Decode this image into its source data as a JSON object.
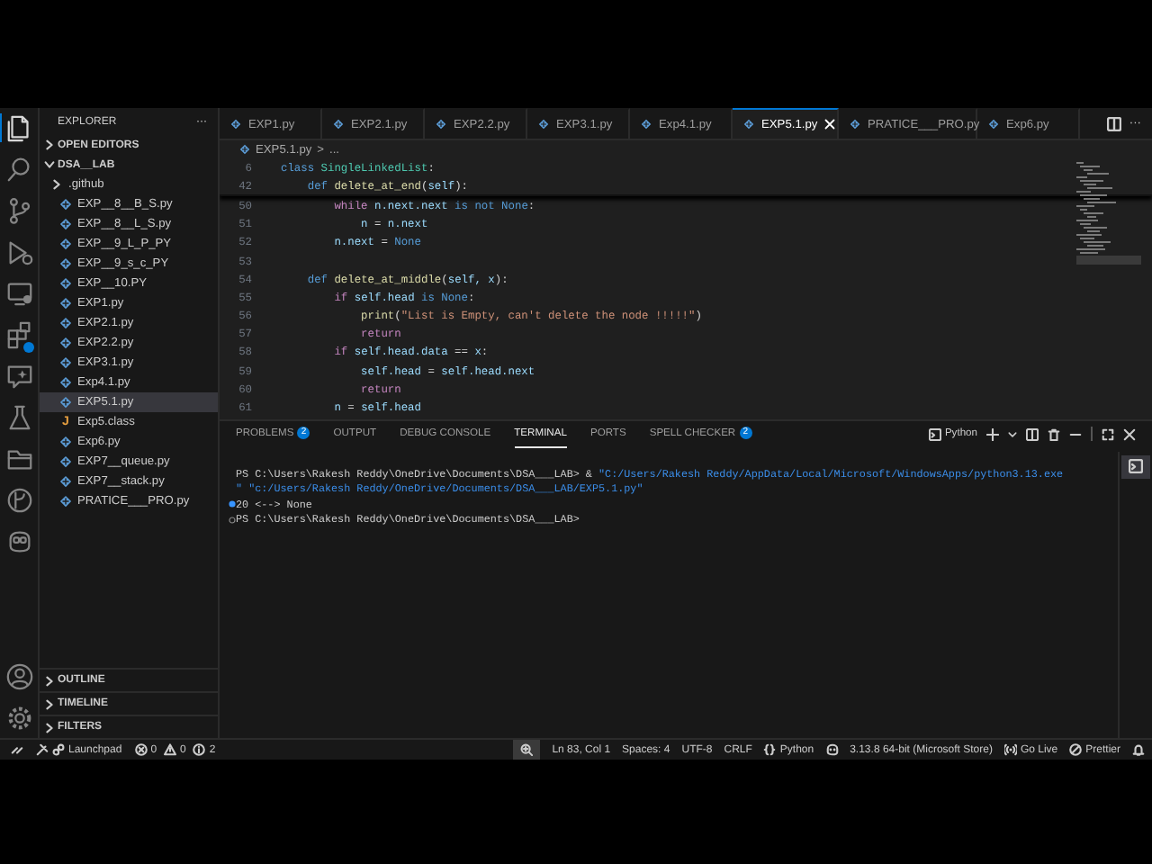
{
  "activity_bar": {
    "items": [
      {
        "kind": "explorer",
        "selected": true,
        "badge": false
      },
      {
        "kind": "search",
        "selected": false,
        "badge": false
      },
      {
        "kind": "source-control",
        "selected": false,
        "badge": false
      },
      {
        "kind": "run-debug",
        "selected": false,
        "badge": false
      },
      {
        "kind": "remote",
        "selected": false,
        "badge": false
      },
      {
        "kind": "extensions",
        "selected": false,
        "badge": true
      },
      {
        "kind": "chat",
        "selected": false,
        "badge": false
      },
      {
        "kind": "testing",
        "selected": false,
        "badge": false
      },
      {
        "kind": "folder",
        "selected": false,
        "badge": false
      },
      {
        "kind": "git-graph",
        "selected": false,
        "badge": false
      },
      {
        "kind": "robot",
        "selected": false,
        "badge": false
      }
    ],
    "bottom": [
      {
        "kind": "account",
        "selected": false
      },
      {
        "kind": "settings",
        "selected": false
      }
    ]
  },
  "sidebar": {
    "title": "EXPLORER",
    "more": "···",
    "sections": [
      {
        "label": "OPEN EDITORS",
        "expanded": false
      },
      {
        "label": "DSA__LAB",
        "expanded": true
      }
    ],
    "items": [
      {
        "kind": "folder",
        "label": ".github",
        "expanded": false,
        "selected": false
      },
      {
        "kind": "python",
        "label": "EXP__8__B_S.py",
        "selected": false
      },
      {
        "kind": "python",
        "label": "EXP__8__L_S.py",
        "selected": false
      },
      {
        "kind": "python",
        "label": "EXP__9_L_P_PY",
        "selected": false
      },
      {
        "kind": "python",
        "label": "EXP__9_s_c_PY",
        "selected": false
      },
      {
        "kind": "python",
        "label": "EXP__10.PY",
        "selected": false
      },
      {
        "kind": "python",
        "label": "EXP1.py",
        "selected": false
      },
      {
        "kind": "python",
        "label": "EXP2.1.py",
        "selected": false
      },
      {
        "kind": "python",
        "label": "EXP2.2.py",
        "selected": false
      },
      {
        "kind": "python",
        "label": "EXP3.1.py",
        "selected": false
      },
      {
        "kind": "python",
        "label": "Exp4.1.py",
        "selected": false
      },
      {
        "kind": "python",
        "label": "EXP5.1.py",
        "selected": true
      },
      {
        "kind": "java",
        "glyph": "J",
        "label": "Exp5.class",
        "selected": false
      },
      {
        "kind": "python",
        "label": "Exp6.py",
        "selected": false
      },
      {
        "kind": "python",
        "label": "EXP7__queue.py",
        "selected": false
      },
      {
        "kind": "python",
        "label": "EXP7__stack.py",
        "selected": false
      },
      {
        "kind": "python",
        "label": "PRATICE___PRO.py",
        "selected": false
      }
    ],
    "bottom_sections": [
      {
        "label": "OUTLINE",
        "expanded": false
      },
      {
        "label": "TIMELINE",
        "expanded": false
      },
      {
        "label": "FILTERS",
        "expanded": false
      }
    ]
  },
  "editor": {
    "tabs": [
      {
        "label": "EXP1.py",
        "selected": false
      },
      {
        "label": "EXP2.1.py",
        "selected": false
      },
      {
        "label": "EXP2.2.py",
        "selected": false
      },
      {
        "label": "EXP3.1.py",
        "selected": false
      },
      {
        "label": "Exp4.1.py",
        "selected": false
      },
      {
        "label": "EXP5.1.py",
        "selected": true
      },
      {
        "label": "PRATICE___PRO.py",
        "selected": false
      },
      {
        "label": "Exp6.py",
        "selected": false
      }
    ],
    "tab_more": "···",
    "breadcrumb": {
      "file": "EXP5.1.py",
      "separator": ">",
      "rest": "..."
    },
    "sticky_lines": [
      {
        "number": "6",
        "tokens": [
          {
            "kind": "kw",
            "text": "class "
          },
          {
            "kind": "cls",
            "text": "SingleLinkedList"
          },
          {
            "kind": "op",
            "text": ":"
          }
        ]
      },
      {
        "number": "42",
        "tokens": [
          {
            "kind": "kw",
            "text": "    def "
          },
          {
            "kind": "fn",
            "text": "delete_at_end"
          },
          {
            "kind": "op",
            "text": "("
          },
          {
            "kind": "var",
            "text": "self"
          },
          {
            "kind": "op",
            "text": "):"
          }
        ]
      }
    ],
    "lines": [
      {
        "number": "50",
        "tokens": [
          {
            "kind": "ctl",
            "text": "        while "
          },
          {
            "kind": "var",
            "text": "n.next.next"
          },
          {
            "kind": "kw",
            "text": " is not None"
          },
          {
            "kind": "op",
            "text": ":"
          }
        ]
      },
      {
        "number": "51",
        "tokens": [
          {
            "kind": "var",
            "text": "            n"
          },
          {
            "kind": "op",
            "text": " = "
          },
          {
            "kind": "var",
            "text": "n.next"
          }
        ]
      },
      {
        "number": "52",
        "tokens": [
          {
            "kind": "var",
            "text": "        n.next"
          },
          {
            "kind": "op",
            "text": " = "
          },
          {
            "kind": "kw",
            "text": "None"
          }
        ]
      },
      {
        "number": "53"
      },
      {
        "number": "54",
        "tokens": [
          {
            "kind": "kw",
            "text": "    def "
          },
          {
            "kind": "fn",
            "text": "delete_at_middle"
          },
          {
            "kind": "op",
            "text": "("
          },
          {
            "kind": "var",
            "text": "self, x"
          },
          {
            "kind": "op",
            "text": "):"
          }
        ]
      },
      {
        "number": "55",
        "tokens": [
          {
            "kind": "ctl",
            "text": "        if "
          },
          {
            "kind": "var",
            "text": "self.head"
          },
          {
            "kind": "kw",
            "text": " is None"
          },
          {
            "kind": "op",
            "text": ":"
          }
        ]
      },
      {
        "number": "56",
        "tokens": [
          {
            "kind": "fn",
            "text": "            print"
          },
          {
            "kind": "op",
            "text": "("
          },
          {
            "kind": "str",
            "text": "\"List is Empty, can't delete the node !!!!!\""
          },
          {
            "kind": "op",
            "text": ")"
          }
        ]
      },
      {
        "number": "57",
        "tokens": [
          {
            "kind": "ctl",
            "text": "            return"
          }
        ]
      },
      {
        "number": "58",
        "tokens": [
          {
            "kind": "ctl",
            "text": "        if "
          },
          {
            "kind": "var",
            "text": "self.head.data"
          },
          {
            "kind": "op",
            "text": " == "
          },
          {
            "kind": "var",
            "text": "x"
          },
          {
            "kind": "op",
            "text": ":"
          }
        ]
      },
      {
        "number": "59",
        "tokens": [
          {
            "kind": "var",
            "text": "            self.head"
          },
          {
            "kind": "op",
            "text": " = "
          },
          {
            "kind": "var",
            "text": "self.head.next"
          }
        ]
      },
      {
        "number": "60",
        "tokens": [
          {
            "kind": "ctl",
            "text": "            return"
          }
        ]
      },
      {
        "number": "61",
        "tokens": [
          {
            "kind": "var",
            "text": "        n"
          },
          {
            "kind": "op",
            "text": " = "
          },
          {
            "kind": "var",
            "text": "self.head"
          }
        ]
      }
    ]
  },
  "panel": {
    "tabs": [
      {
        "label": "PROBLEMS",
        "badge": "2",
        "selected": false
      },
      {
        "label": "OUTPUT",
        "selected": false
      },
      {
        "label": "DEBUG CONSOLE",
        "selected": false
      },
      {
        "label": "TERMINAL",
        "selected": true
      },
      {
        "label": "PORTS",
        "selected": false
      },
      {
        "label": "SPELL CHECKER",
        "badge": "2",
        "selected": false
      }
    ],
    "terminal_profile": "Python",
    "terminal_lines": [
      {
        "kind": "plain",
        "segments": [
          {
            "kind": "plain",
            "text": "PS C:\\Users\\Rakesh Reddy\\OneDrive\\Documents\\DSA___LAB> & "
          },
          {
            "kind": "str",
            "text": "\"C:/Users/Rakesh Reddy/AppData/Local/Microsoft/WindowsApps/python3.13.exe"
          }
        ]
      },
      {
        "kind": "plain",
        "segments": [
          {
            "kind": "str",
            "text": "\" \"c:/Users/Rakesh Reddy/OneDrive/Documents/DSA___LAB/EXP5.1.py\""
          }
        ]
      },
      {
        "kind": "success",
        "segments": [
          {
            "kind": "plain",
            "text": "20 <--> None"
          }
        ]
      },
      {
        "kind": "idle",
        "segments": [
          {
            "kind": "plain",
            "text": "PS C:\\Users\\Rakesh Reddy\\OneDrive\\Documents\\DSA___LAB>"
          }
        ]
      }
    ]
  },
  "status_bar": {
    "left": [
      {
        "kind": "remote"
      },
      {
        "kind": "launchpad",
        "text": "Launchpad"
      },
      {
        "kind": "errors",
        "text": "0"
      },
      {
        "kind": "warnings",
        "text": "0"
      },
      {
        "kind": "infos",
        "text": "2"
      }
    ],
    "right": [
      {
        "kind": "zoom"
      },
      {
        "kind": "text",
        "text": "Ln 83, Col 1"
      },
      {
        "kind": "text",
        "text": "Spaces: 4"
      },
      {
        "kind": "text",
        "text": "UTF-8"
      },
      {
        "kind": "text",
        "text": "CRLF"
      },
      {
        "kind": "language",
        "text": "Python"
      },
      {
        "kind": "robot"
      },
      {
        "kind": "text",
        "text": "3.13.8 64-bit (Microsoft Store)"
      },
      {
        "kind": "golive",
        "text": "Go Live"
      },
      {
        "kind": "prettier",
        "text": "Prettier"
      },
      {
        "kind": "bell"
      }
    ]
  }
}
